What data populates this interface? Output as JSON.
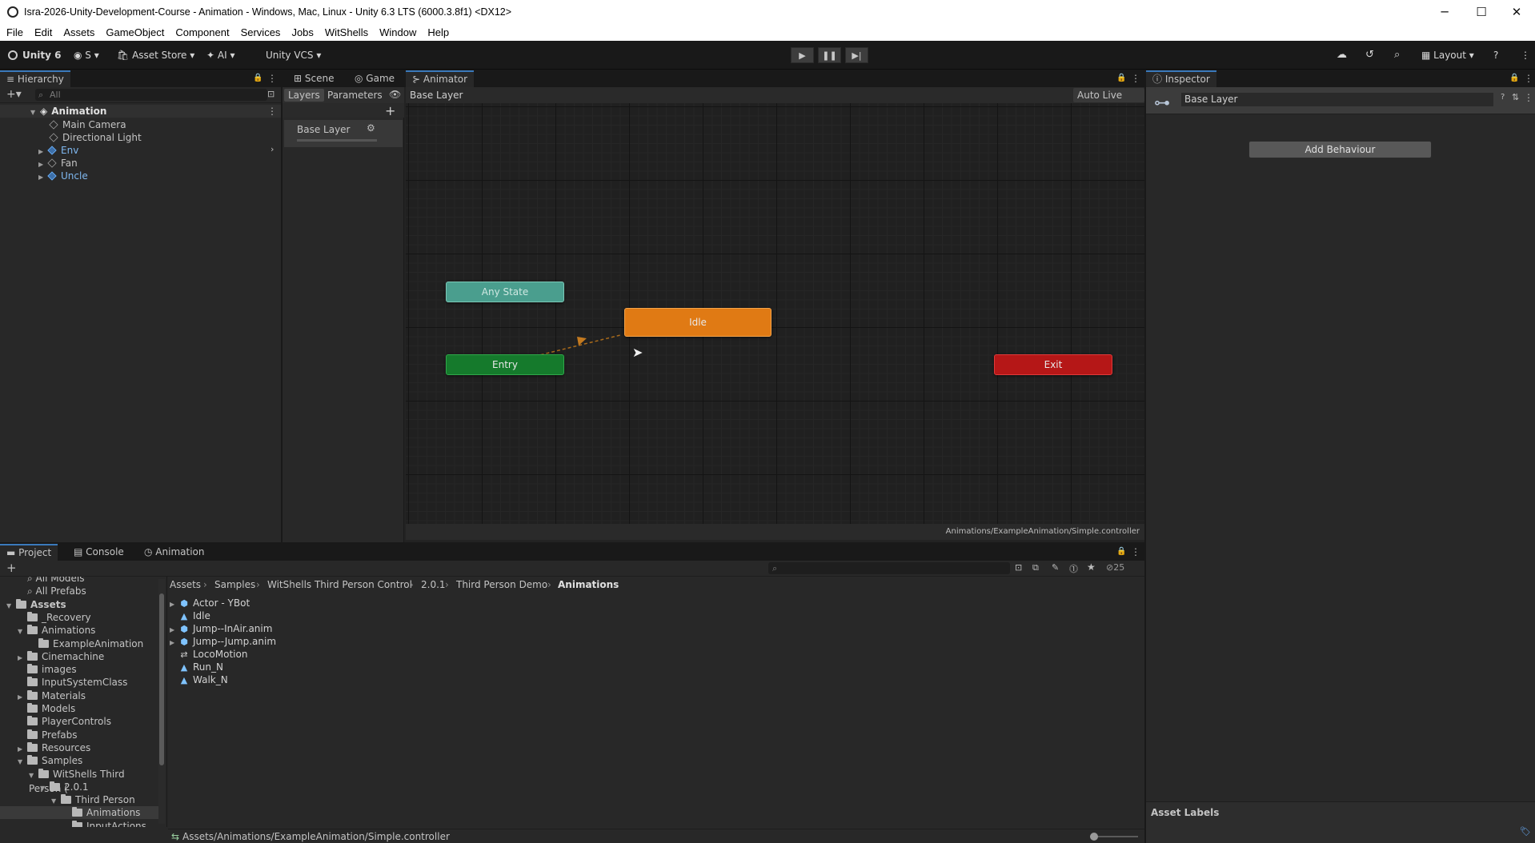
{
  "window": {
    "title": "Isra-2026-Unity-Development-Course - Animation - Windows, Mac, Linux - Unity 6.3 LTS (6000.3.8f1) <DX12>",
    "controls": [
      "─",
      "☐",
      "✕"
    ]
  },
  "menu": [
    "File",
    "Edit",
    "Assets",
    "GameObject",
    "Component",
    "Services",
    "Jobs",
    "WitShells",
    "Window",
    "Help"
  ],
  "toolbar": {
    "unity_label": "Unity 6",
    "account_label": "S",
    "asset_store_label": "Asset Store",
    "ai_label": "AI",
    "vcs_label": "Unity VCS",
    "layout_label": "Layout"
  },
  "hierarchy": {
    "tab_label": "Hierarchy",
    "search_placeholder": "All",
    "scene_name": "Animation",
    "items": [
      "Main Camera",
      "Directional Light",
      "Env",
      "Fan",
      "Uncle"
    ]
  },
  "center_tabs": [
    "Scene",
    "Game",
    "Animator"
  ],
  "animator": {
    "layers_tab": "Layers",
    "parameters_tab": "Parameters",
    "layer_name": "Base Layer",
    "breadcrumb": "Base Layer",
    "auto_live_link": "Auto Live Link",
    "nodes": {
      "any_state": "Any State",
      "idle": "Idle",
      "entry": "Entry",
      "exit": "Exit"
    },
    "footer_path": "Animations/ExampleAnimation/Simple.controller"
  },
  "inspector": {
    "tab_label": "Inspector",
    "object_name": "Base Layer",
    "add_behaviour": "Add Behaviour",
    "asset_labels": "Asset Labels"
  },
  "bottom_tabs": [
    "Project",
    "Console",
    "Animation"
  ],
  "project": {
    "search_placeholder": "",
    "hidden_count": "25",
    "tree": [
      {
        "label": "All Models",
        "indent": 1,
        "kind": "search"
      },
      {
        "label": "All Prefabs",
        "indent": 1,
        "kind": "search"
      },
      {
        "label": "Assets",
        "indent": 0,
        "kind": "root"
      },
      {
        "label": "_Recovery",
        "indent": 1,
        "kind": "folder"
      },
      {
        "label": "Animations",
        "indent": 1,
        "kind": "folder"
      },
      {
        "label": "ExampleAnimation",
        "indent": 2,
        "kind": "folder"
      },
      {
        "label": "Cinemachine",
        "indent": 1,
        "kind": "folder"
      },
      {
        "label": "images",
        "indent": 1,
        "kind": "folder"
      },
      {
        "label": "InputSystemClass",
        "indent": 1,
        "kind": "folder"
      },
      {
        "label": "Materials",
        "indent": 1,
        "kind": "folder"
      },
      {
        "label": "Models",
        "indent": 1,
        "kind": "folder"
      },
      {
        "label": "PlayerControls",
        "indent": 1,
        "kind": "folder"
      },
      {
        "label": "Prefabs",
        "indent": 1,
        "kind": "folder"
      },
      {
        "label": "Resources",
        "indent": 1,
        "kind": "folder"
      },
      {
        "label": "Samples",
        "indent": 1,
        "kind": "folder"
      },
      {
        "label": "WitShells Third Person (",
        "indent": 2,
        "kind": "folder"
      },
      {
        "label": "2.0.1",
        "indent": 3,
        "kind": "folder"
      },
      {
        "label": "Third Person Demo",
        "indent": 4,
        "kind": "folder"
      },
      {
        "label": "Animations",
        "indent": 5,
        "kind": "folder"
      },
      {
        "label": "InputActions",
        "indent": 5,
        "kind": "folder"
      }
    ],
    "breadcrumb": [
      "Assets",
      "Samples",
      "WitShells Third Person Control",
      "2.0.1",
      "Third Person Demo",
      "Animations"
    ],
    "assets": [
      {
        "label": "Actor - YBot",
        "icon": "model"
      },
      {
        "label": "Idle",
        "icon": "clip"
      },
      {
        "label": "Jump--InAir.anim",
        "icon": "model"
      },
      {
        "label": "Jump--Jump.anim",
        "icon": "model"
      },
      {
        "label": "LocoMotion",
        "icon": "blend"
      },
      {
        "label": "Run_N",
        "icon": "clip"
      },
      {
        "label": "Walk_N",
        "icon": "clip"
      }
    ],
    "status_path": "Assets/Animations/ExampleAnimation/Simple.controller"
  }
}
